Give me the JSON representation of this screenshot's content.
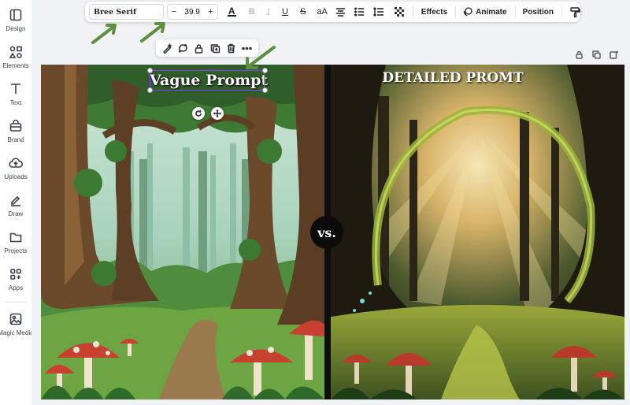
{
  "sidebar": {
    "items": [
      {
        "label": "Design",
        "icon": "design-icon"
      },
      {
        "label": "Elements",
        "icon": "elements-icon"
      },
      {
        "label": "Text",
        "icon": "text-icon"
      },
      {
        "label": "Brand",
        "icon": "brand-icon"
      },
      {
        "label": "Uploads",
        "icon": "uploads-icon"
      },
      {
        "label": "Draw",
        "icon": "draw-icon"
      },
      {
        "label": "Projects",
        "icon": "projects-icon"
      },
      {
        "label": "Apps",
        "icon": "apps-icon"
      },
      {
        "label": "Magic Media",
        "icon": "magic-media-icon"
      }
    ]
  },
  "toolbar": {
    "font_family": "Bree Serif",
    "font_size": "39.9",
    "decrease_label": "−",
    "increase_label": "+",
    "text_color_label": "A",
    "bold_label": "B",
    "italic_label": "I",
    "underline_label": "U",
    "strike_label": "S",
    "case_label": "aA",
    "effects_label": "Effects",
    "animate_label": "Animate",
    "position_label": "Position"
  },
  "canvas": {
    "left_title": "Vague Prompt",
    "right_title": "DETAILED PROMT",
    "vs_label": "vs."
  },
  "colors": {
    "selection": "#8b3dff",
    "annotation_arrow": "#5e8f3e",
    "accent_text_underline": "#8b3dff"
  }
}
